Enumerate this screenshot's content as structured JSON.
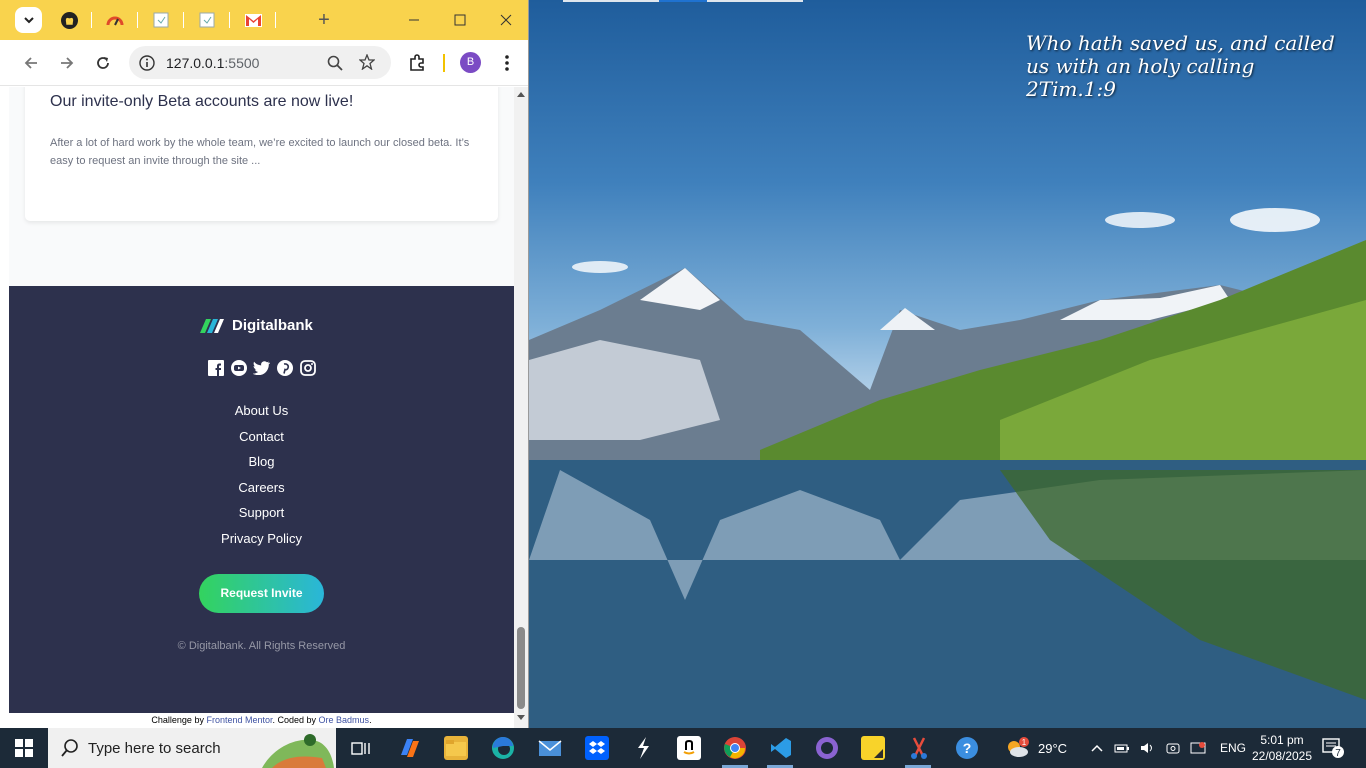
{
  "desktop": {
    "quote_line1": "Who hath saved us, and called",
    "quote_line2": "us with an holy calling",
    "quote_line3": "2Tim.1:9"
  },
  "browser": {
    "tabs": [
      {
        "icon": "github-icon"
      },
      {
        "icon": "speedometer-icon"
      },
      {
        "icon": "page-icon"
      },
      {
        "icon": "page-icon"
      },
      {
        "icon": "gmail-icon"
      }
    ],
    "new_tab": "+",
    "address_host": "127.0.0.1",
    "address_port": ":5500",
    "profile_initial": "B",
    "accent": "#f9d34d"
  },
  "page": {
    "card": {
      "title": "Our invite-only Beta accounts are now live!",
      "text": "After a lot of hard work by the whole team, we’re excited to launch our closed beta. It’s easy to request an invite through the site ..."
    },
    "footer": {
      "brand": "Digitalbank",
      "socials": [
        "facebook-icon",
        "youtube-icon",
        "twitter-icon",
        "pinterest-icon",
        "instagram-icon"
      ],
      "links": [
        "About Us",
        "Contact",
        "Blog",
        "Careers",
        "Support",
        "Privacy Policy"
      ],
      "cta": "Request Invite",
      "copyright": "© Digitalbank. All Rights Reserved"
    },
    "attribution": {
      "prefix": "Challenge by ",
      "fm": "Frontend Mentor",
      "middle": ". Coded by ",
      "author": "Ore Badmus",
      "suffix": "."
    }
  },
  "taskbar": {
    "search_placeholder": "Type here to search",
    "apps": [
      "task-view-icon",
      "copilot-icon",
      "file-explorer-icon",
      "edge-icon",
      "mail-icon",
      "dropbox-icon",
      "app-s-icon",
      "amazon-icon",
      "chrome-icon",
      "vscode-icon",
      "github-desktop-icon",
      "sticky-notes-icon",
      "snipping-tool-icon",
      "help-icon"
    ],
    "weather_temp": "29°C",
    "weather_badge": "1",
    "language": "ENG",
    "time": "5:01 pm",
    "date": "22/08/2025",
    "notification_count": "7"
  }
}
